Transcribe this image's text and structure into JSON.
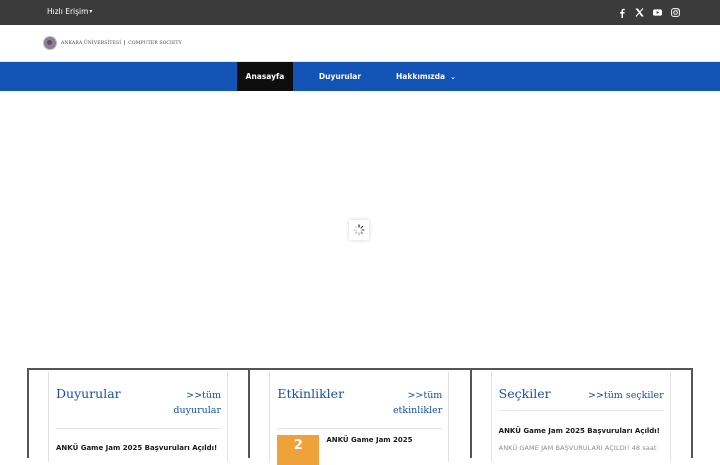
{
  "topbar": {
    "quick_access": "Hızlı Erişim",
    "socials": [
      {
        "icon": "facebook-icon"
      },
      {
        "icon": "x-twitter-icon"
      },
      {
        "icon": "youtube-icon"
      },
      {
        "icon": "instagram-icon"
      }
    ]
  },
  "logo": {
    "university": "ANKARA ÜNİVERSİTESİ",
    "society": "COMPUTER SOCIETY"
  },
  "nav": {
    "items": [
      {
        "label": "Anasayfa",
        "active": true
      },
      {
        "label": "Duyurular",
        "active": false
      },
      {
        "label": "Hakkımızda",
        "active": false,
        "dropdown": true
      }
    ]
  },
  "colors": {
    "topbar": "#3b3b3b",
    "nav": "#1353b5",
    "nav_active": "#0e0e0e",
    "heading": "#1a4fa0",
    "date_badge": "#f0a23a"
  },
  "columns": [
    {
      "title": "Duyurular",
      "link_line1": ">>tüm",
      "link_line2": "duyurular",
      "post_title": "ANKÜ Game Jam 2025 Başvuruları Açıldı!"
    },
    {
      "title": "Etkinlikler",
      "link_line1": ">>tüm",
      "link_line2": "etkinlikler",
      "date_day": "2",
      "post_title": "ANKÜ Game Jam 2025"
    },
    {
      "title": "Seçkiler",
      "link": ">>tüm seçkiler",
      "post_title": "ANKÜ Game Jam 2025 Başvuruları Açıldı!",
      "post_excerpt": "ANKÜ GAME JAM BAŞVURULARI AÇILDI! 48 saat"
    }
  ]
}
